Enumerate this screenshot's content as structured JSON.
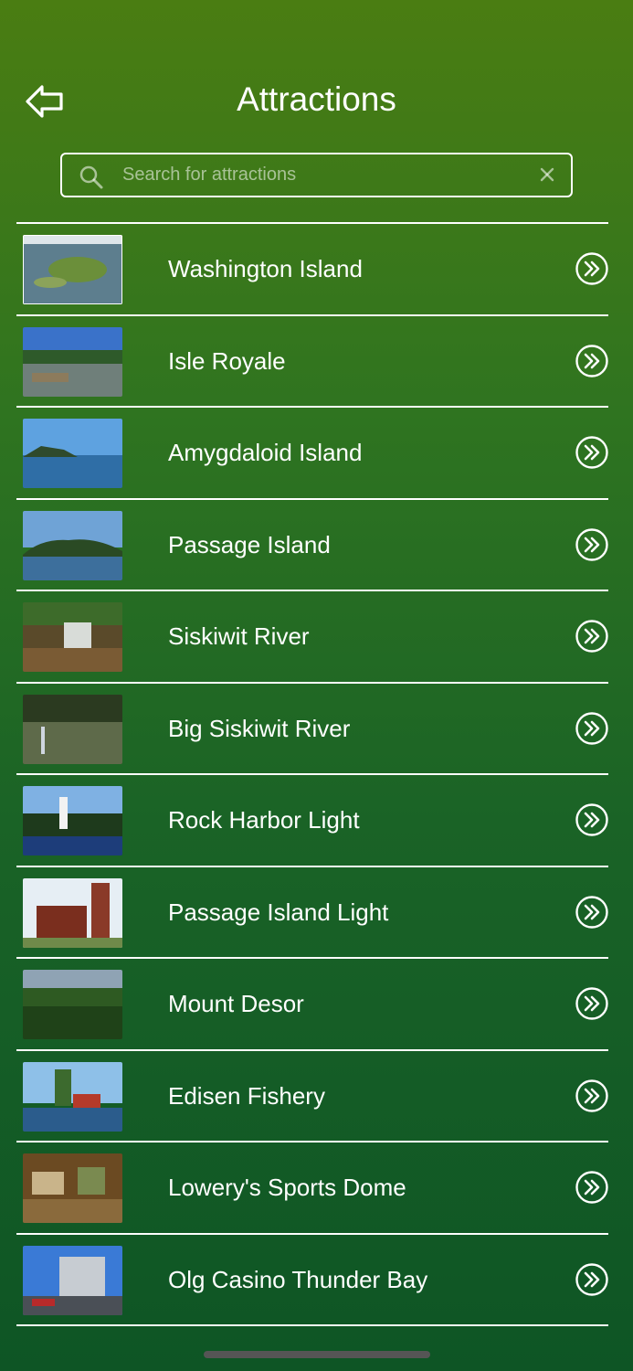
{
  "header": {
    "title": "Attractions",
    "back_icon": "back-arrow-icon"
  },
  "search": {
    "placeholder": "Search for attractions",
    "value": "",
    "search_icon": "search-icon",
    "clear_icon": "close-icon"
  },
  "attractions": [
    {
      "label": "Washington Island",
      "thumb": "island-aerial"
    },
    {
      "label": "Isle Royale",
      "thumb": "lake-shore"
    },
    {
      "label": "Amygdaloid Island",
      "thumb": "lake-island"
    },
    {
      "label": "Passage Island",
      "thumb": "forested-island"
    },
    {
      "label": "Siskiwit River",
      "thumb": "waterfall"
    },
    {
      "label": "Big Siskiwit River",
      "thumb": "river-fishing"
    },
    {
      "label": "Rock Harbor Light",
      "thumb": "lighthouse"
    },
    {
      "label": "Passage Island Light",
      "thumb": "brick-lighthouse"
    },
    {
      "label": "Mount Desor",
      "thumb": "forest-view"
    },
    {
      "label": "Edisen Fishery",
      "thumb": "fishery-dock"
    },
    {
      "label": "Lowery's Sports Dome",
      "thumb": "mini-golf"
    },
    {
      "label": "Olg Casino Thunder Bay",
      "thumb": "casino-building"
    }
  ],
  "row_action_icon": "chevron-right-circle-icon",
  "colors": {
    "gradient_top": "#4a7d12",
    "gradient_bottom": "#0e5525",
    "text": "#ffffff"
  }
}
